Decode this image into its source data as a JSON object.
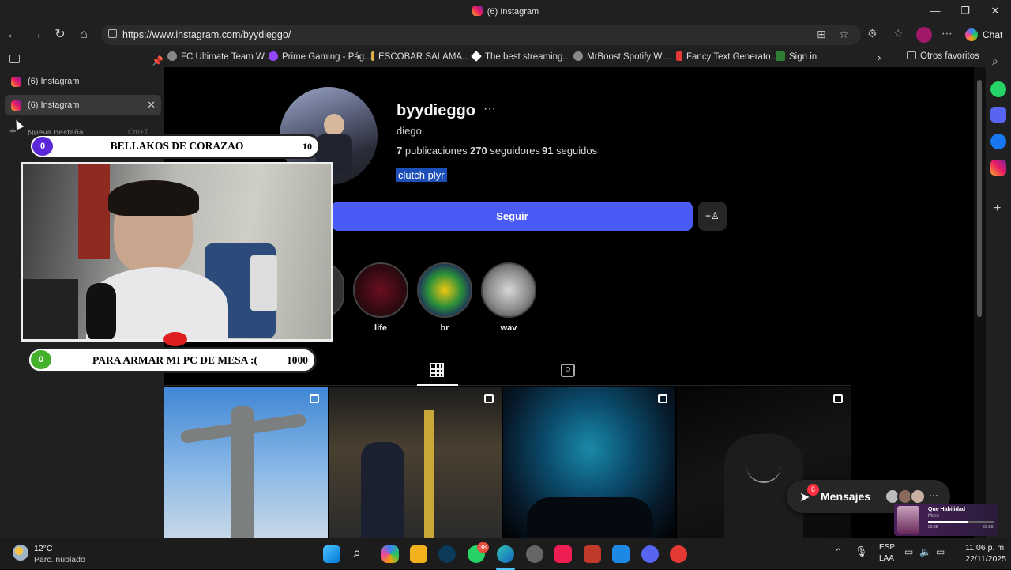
{
  "window": {
    "title": "(6) Instagram",
    "controls": {
      "minimize": "—",
      "maximize": "❐",
      "close": "✕"
    }
  },
  "toolbar": {
    "url": "https://www.instagram.com/byydieggo/",
    "chat_label": "Chat"
  },
  "favorites": [
    {
      "label": "FC Ultimate Team W...",
      "color": "#cccccc"
    },
    {
      "label": "Prime Gaming - Pág...",
      "color": "#9146ff"
    },
    {
      "label": "ESCOBAR SALAMA...",
      "color": "#e0b04a"
    },
    {
      "label": "The best streaming...",
      "color": "#ffffff"
    },
    {
      "label": "MrBoost Spotify Wi...",
      "color": "#cccccc"
    },
    {
      "label": "Fancy Text Generato...",
      "color": "#e53935"
    },
    {
      "label": "Sign in",
      "color": "#2e7d32"
    }
  ],
  "favorites_other": "Otros favoritos",
  "tabs": [
    {
      "label": "(6) Instagram"
    },
    {
      "label": "(6) Instagram"
    }
  ],
  "new_tab": {
    "label": "Nueva pestaña",
    "shortcut": "Ctrl+T"
  },
  "profile": {
    "username": "byydieggo",
    "name": "diego",
    "posts_count": "7",
    "posts_label": "publicaciones",
    "followers_count": "270",
    "followers_label": "seguidores",
    "following_count": "91",
    "following_label": "seguidos",
    "bio": "clutch plyr",
    "follow_button": "Seguir"
  },
  "highlights": [
    {
      "label": "life"
    },
    {
      "label": "br"
    },
    {
      "label": "wav"
    }
  ],
  "messages": {
    "label": "Mensajes",
    "badge": "6"
  },
  "overlay": {
    "goal1": {
      "start": "0",
      "text": "BELLAKOS DE CORAZAO",
      "end": "10",
      "progress": 0.06
    },
    "goal2": {
      "start": "0",
      "text": "PARA ARMAR MI PC DE MESA :(",
      "end": "1000",
      "progress": 0.0
    },
    "mini_player": {
      "title": "Que Habilidad",
      "artist": "Moro",
      "elapsed": "02:25",
      "total": "03:59"
    }
  },
  "weather": {
    "temp": "12°C",
    "desc": "Parc. nublado"
  },
  "tray": {
    "lang": "ESP",
    "layout": "LAA",
    "time": "11:06 p. m.",
    "date": "22/11/2025",
    "whatsapp_badge": "38"
  }
}
